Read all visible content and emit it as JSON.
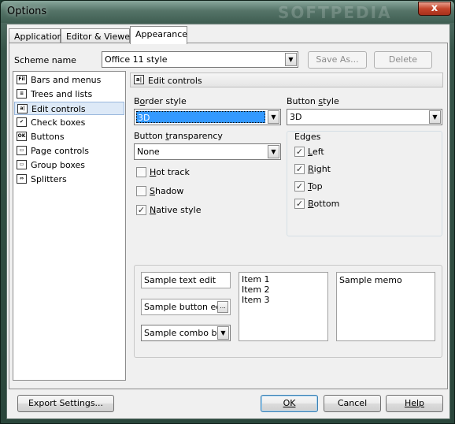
{
  "window": {
    "title": "Options",
    "watermark": "SOFTPEDIA",
    "close_glyph": "x"
  },
  "tabs": [
    "Application",
    "Editor & Viewers",
    "Appearance"
  ],
  "scheme": {
    "label": "Scheme name",
    "value": "Office 11 style",
    "save_as": "Save As...",
    "delete": "Delete"
  },
  "categories": [
    {
      "label": "Bars and menus",
      "icon": "menu-icon",
      "glyph": "Fil"
    },
    {
      "label": "Trees and lists",
      "icon": "tree-list-icon",
      "glyph": "≡"
    },
    {
      "label": "Edit controls",
      "icon": "edit-control-icon",
      "glyph": "a|"
    },
    {
      "label": "Check boxes",
      "icon": "checkbox-icon",
      "glyph": "✔"
    },
    {
      "label": "Buttons",
      "icon": "button-icon",
      "glyph": "OK"
    },
    {
      "label": "Page controls",
      "icon": "page-control-icon",
      "glyph": "▭"
    },
    {
      "label": "Group boxes",
      "icon": "group-box-icon",
      "glyph": "▭"
    },
    {
      "label": "Splitters",
      "icon": "splitter-icon",
      "glyph": "⇔"
    }
  ],
  "section_title": "Edit controls",
  "border_style": {
    "label_pre": "B",
    "label_u": "o",
    "label_post": "rder style",
    "value": "3D"
  },
  "button_style": {
    "label_pre": "Button ",
    "label_u": "s",
    "label_post": "tyle",
    "value": "3D"
  },
  "button_transparency": {
    "label_pre": "Button ",
    "label_u": "t",
    "label_post": "ransparency",
    "value": "None"
  },
  "options": [
    {
      "u": "H",
      "rest": "ot track",
      "checked": false
    },
    {
      "u": "S",
      "rest": "hadow",
      "checked": false
    },
    {
      "u": "N",
      "rest": "ative style",
      "checked": true
    }
  ],
  "edges": {
    "title": "Edges",
    "items": [
      {
        "u": "L",
        "rest": "eft",
        "checked": true
      },
      {
        "u": "R",
        "rest": "ight",
        "checked": true
      },
      {
        "u": "T",
        "rest": "op",
        "checked": true
      },
      {
        "u": "B",
        "rest": "ottom",
        "checked": true
      }
    ]
  },
  "samples": {
    "text_edit": "Sample text edit",
    "button_edit": "Sample button edit",
    "combo_box": "Sample combo box",
    "list_items": [
      "Item 1",
      "Item 2",
      "Item 3"
    ],
    "memo": "Sample memo"
  },
  "footer": {
    "export": "Export Settings...",
    "ok": "OK",
    "cancel": "Cancel",
    "help": "Help"
  },
  "check_glyph": "✓",
  "arrow_glyph": "▼",
  "ellipsis_glyph": "..."
}
